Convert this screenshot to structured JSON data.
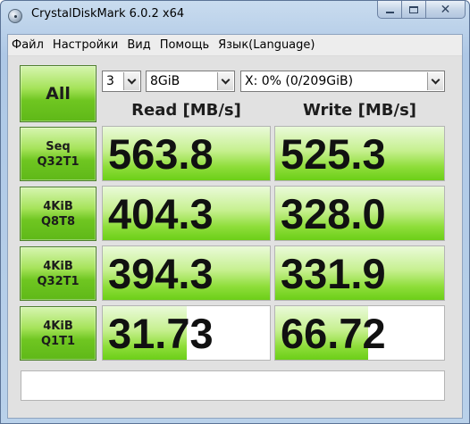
{
  "window": {
    "title": "CrystalDiskMark 6.0.2 x64"
  },
  "menu": [
    "Файл",
    "Настройки",
    "Вид",
    "Помощь",
    "Язык(Language)"
  ],
  "controls": {
    "all_label": "All",
    "test_count": "3",
    "test_size": "8GiB",
    "drive": "X: 0% (0/209GiB)"
  },
  "headers": {
    "read": "Read [MB/s]",
    "write": "Write [MB/s]"
  },
  "tests": [
    {
      "line1": "Seq",
      "line2": "Q32T1",
      "read": "563.8",
      "write": "525.3",
      "read_fill": 1.0,
      "write_fill": 1.0
    },
    {
      "line1": "4KiB",
      "line2": "Q8T8",
      "read": "404.3",
      "write": "328.0",
      "read_fill": 1.0,
      "write_fill": 1.0
    },
    {
      "line1": "4KiB",
      "line2": "Q32T1",
      "read": "394.3",
      "write": "331.9",
      "read_fill": 1.0,
      "write_fill": 1.0
    },
    {
      "line1": "4KiB",
      "line2": "Q1T1",
      "read": "31.73",
      "write": "66.72",
      "read_fill": 0.5,
      "write_fill": 0.55
    }
  ],
  "comment": "",
  "colors": {
    "green_light": "#d6f5b0",
    "green_dark": "#5fb818",
    "bar_green": "#8ede3a"
  },
  "icons": {
    "app": "crystaldiskmark-disc-icon",
    "minimize": "minimize-icon",
    "maximize": "maximize-icon",
    "close": "close-icon",
    "dropdown": "chevron-down-icon"
  }
}
